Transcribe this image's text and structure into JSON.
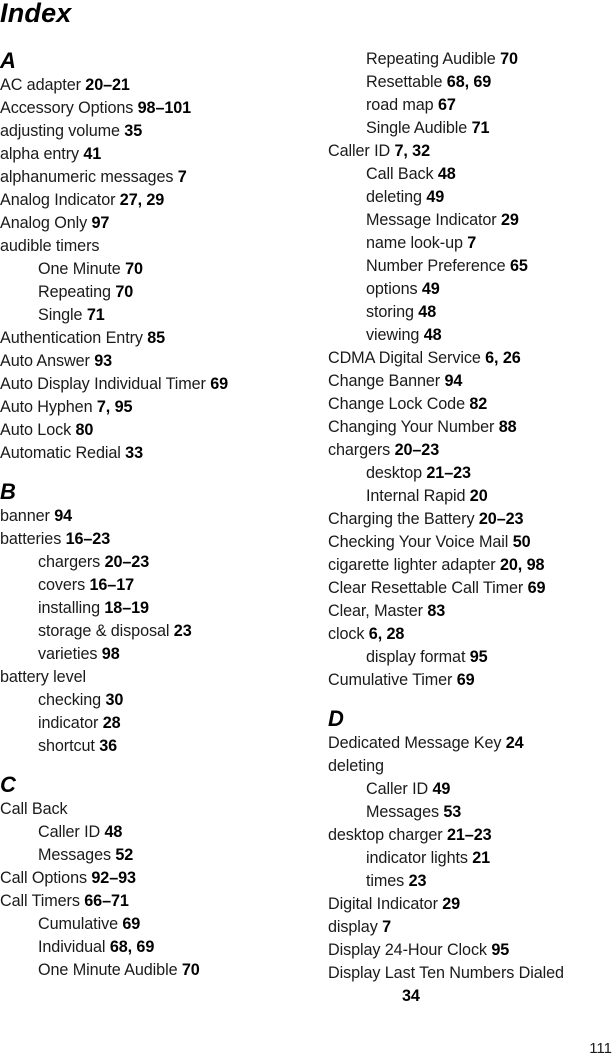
{
  "title": "Index",
  "page_number": "111",
  "columns": [
    {
      "sections": [
        {
          "letter": "A",
          "entries": [
            {
              "term": "AC adapter",
              "pages": "20–21",
              "level": 0
            },
            {
              "term": "Accessory Options",
              "pages": "98–101",
              "level": 0
            },
            {
              "term": "adjusting volume",
              "pages": "35",
              "level": 0
            },
            {
              "term": "alpha entry",
              "pages": "41",
              "level": 0
            },
            {
              "term": "alphanumeric messages",
              "pages": "7",
              "level": 0
            },
            {
              "term": "Analog Indicator",
              "pages": "27, 29",
              "level": 0
            },
            {
              "term": "Analog Only",
              "pages": "97",
              "level": 0
            },
            {
              "term": "audible timers",
              "pages": "",
              "level": 0
            },
            {
              "term": "One Minute",
              "pages": "70",
              "level": 1
            },
            {
              "term": "Repeating",
              "pages": "70",
              "level": 1
            },
            {
              "term": "Single",
              "pages": "71",
              "level": 1
            },
            {
              "term": "Authentication Entry",
              "pages": "85",
              "level": 0
            },
            {
              "term": "Auto Answer",
              "pages": "93",
              "level": 0
            },
            {
              "term": "Auto Display Individual Timer",
              "pages": "69",
              "level": 0
            },
            {
              "term": "Auto Hyphen",
              "pages": "7, 95",
              "level": 0
            },
            {
              "term": "Auto Lock",
              "pages": "80",
              "level": 0
            },
            {
              "term": "Automatic Redial",
              "pages": "33",
              "level": 0
            }
          ]
        },
        {
          "letter": "B",
          "entries": [
            {
              "term": "banner",
              "pages": "94",
              "level": 0
            },
            {
              "term": "batteries",
              "pages": "16–23",
              "level": 0
            },
            {
              "term": "chargers",
              "pages": "20–23",
              "level": 1
            },
            {
              "term": "covers",
              "pages": "16–17",
              "level": 1
            },
            {
              "term": "installing",
              "pages": "18–19",
              "level": 1
            },
            {
              "term": "storage & disposal",
              "pages": "23",
              "level": 1
            },
            {
              "term": "varieties",
              "pages": "98",
              "level": 1
            },
            {
              "term": "battery level",
              "pages": "",
              "level": 0
            },
            {
              "term": "checking",
              "pages": "30",
              "level": 1
            },
            {
              "term": "indicator",
              "pages": "28",
              "level": 1
            },
            {
              "term": "shortcut",
              "pages": "36",
              "level": 1
            }
          ]
        },
        {
          "letter": "C",
          "entries": [
            {
              "term": "Call Back",
              "pages": "",
              "level": 0
            },
            {
              "term": "Caller ID",
              "pages": "48",
              "level": 1
            },
            {
              "term": "Messages",
              "pages": "52",
              "level": 1
            },
            {
              "term": "Call Options",
              "pages": "92–93",
              "level": 0
            },
            {
              "term": "Call Timers",
              "pages": "66–71",
              "level": 0
            },
            {
              "term": "Cumulative",
              "pages": "69",
              "level": 1
            },
            {
              "term": "Individual",
              "pages": "68, 69",
              "level": 1
            },
            {
              "term": "One Minute Audible",
              "pages": "70",
              "level": 1
            }
          ]
        }
      ]
    },
    {
      "sections": [
        {
          "letter": "",
          "entries": [
            {
              "term": "Repeating Audible",
              "pages": "70",
              "level": 1
            },
            {
              "term": "Resettable",
              "pages": "68, 69",
              "level": 1
            },
            {
              "term": "road map",
              "pages": "67",
              "level": 1
            },
            {
              "term": "Single Audible",
              "pages": "71",
              "level": 1
            },
            {
              "term": "Caller ID",
              "pages": "7, 32",
              "level": 0
            },
            {
              "term": "Call Back",
              "pages": "48",
              "level": 1
            },
            {
              "term": "deleting",
              "pages": "49",
              "level": 1
            },
            {
              "term": "Message Indicator",
              "pages": "29",
              "level": 1
            },
            {
              "term": "name look-up",
              "pages": "7",
              "level": 1
            },
            {
              "term": "Number Preference",
              "pages": "65",
              "level": 1
            },
            {
              "term": "options",
              "pages": "49",
              "level": 1
            },
            {
              "term": "storing",
              "pages": "48",
              "level": 1
            },
            {
              "term": "viewing",
              "pages": "48",
              "level": 1
            },
            {
              "term": "CDMA Digital Service",
              "pages": "6, 26",
              "level": 0
            },
            {
              "term": "Change Banner",
              "pages": "94",
              "level": 0
            },
            {
              "term": "Change Lock Code",
              "pages": "82",
              "level": 0
            },
            {
              "term": "Changing Your Number",
              "pages": "88",
              "level": 0
            },
            {
              "term": "chargers",
              "pages": "20–23",
              "level": 0
            },
            {
              "term": "desktop",
              "pages": "21–23",
              "level": 1
            },
            {
              "term": "Internal Rapid",
              "pages": "20",
              "level": 1
            },
            {
              "term": "Charging the Battery",
              "pages": "20–23",
              "level": 0
            },
            {
              "term": "Checking Your Voice Mail",
              "pages": "50",
              "level": 0
            },
            {
              "term": "cigarette lighter adapter",
              "pages": "20, 98",
              "level": 0
            },
            {
              "term": "Clear Resettable Call Timer",
              "pages": "69",
              "level": 0
            },
            {
              "term": "Clear, Master",
              "pages": "83",
              "level": 0
            },
            {
              "term": "clock",
              "pages": "6, 28",
              "level": 0
            },
            {
              "term": "display format",
              "pages": "95",
              "level": 1
            },
            {
              "term": "Cumulative Timer",
              "pages": "69",
              "level": 0
            }
          ]
        },
        {
          "letter": "D",
          "entries": [
            {
              "term": "Dedicated Message Key",
              "pages": "24",
              "level": 0
            },
            {
              "term": "deleting",
              "pages": "",
              "level": 0
            },
            {
              "term": "Caller ID",
              "pages": "49",
              "level": 1
            },
            {
              "term": "Messages",
              "pages": "53",
              "level": 1
            },
            {
              "term": "desktop charger",
              "pages": "21–23",
              "level": 0
            },
            {
              "term": "indicator lights",
              "pages": "21",
              "level": 1
            },
            {
              "term": "times",
              "pages": "23",
              "level": 1
            },
            {
              "term": "Digital Indicator",
              "pages": "29",
              "level": 0
            },
            {
              "term": "display",
              "pages": "7",
              "level": 0
            },
            {
              "term": "Display 24-Hour Clock",
              "pages": "95",
              "level": 0
            },
            {
              "term": "Display Last Ten Numbers Dialed",
              "pages": "34",
              "level": 0,
              "pages_wrapped": true
            }
          ]
        }
      ]
    }
  ]
}
